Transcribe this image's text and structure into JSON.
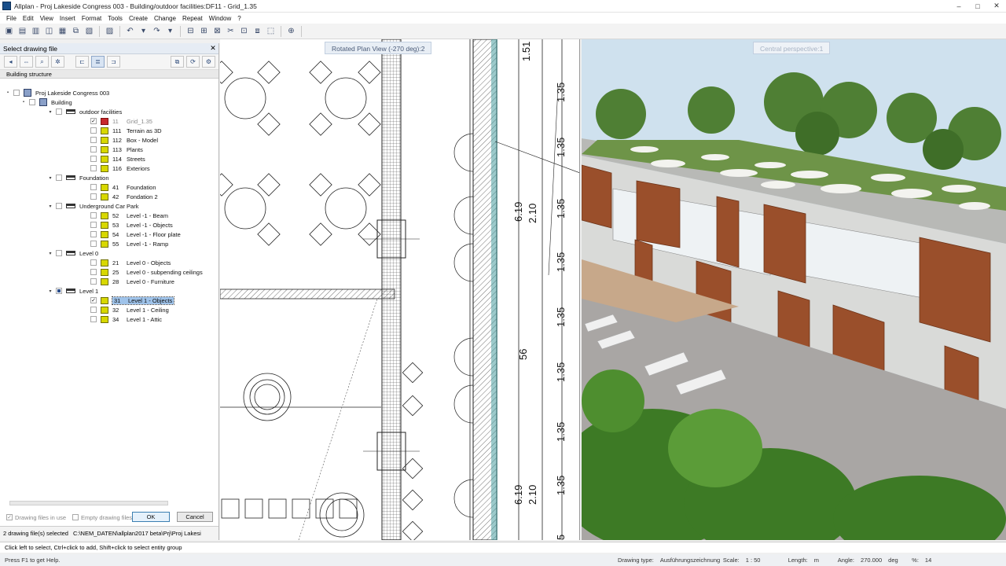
{
  "window": {
    "title": "Allplan - Proj Lakeside Congress 003 - Building/outdoor facilities:DF11 - Grid_1.35",
    "minimize": "–",
    "maximize": "□",
    "close": "✕"
  },
  "menu": [
    "File",
    "Edit",
    "View",
    "Insert",
    "Format",
    "Tools",
    "Create",
    "Change",
    "Repeat",
    "Window",
    "?"
  ],
  "toolbar_icons": [
    "new-icon",
    "open-icon",
    "print-icon",
    "preview-icon",
    "save-icon",
    "copy-icon",
    "paste-icon",
    "undo-icon",
    "redo-icon",
    "snap-icon",
    "grid-icon",
    "move-icon",
    "cut-icon",
    "layer-icon",
    "zoom-icon",
    "help-icon"
  ],
  "panel": {
    "title": "Select drawing file",
    "close": "✕",
    "tab": "Building structure",
    "tree": [
      {
        "level": 0,
        "toggle": "▪",
        "check": "",
        "icon": "bld",
        "num": "",
        "label": "Proj Lakeside Congress 003"
      },
      {
        "level": 1,
        "toggle": "▪",
        "check": "",
        "icon": "bld",
        "num": "",
        "label": "Building"
      },
      {
        "level": 2,
        "toggle": "▾",
        "check": "",
        "icon": "floor",
        "num": "",
        "label": "outdoor facilities"
      },
      {
        "level": 3,
        "toggle": "",
        "check": "✓",
        "icon": "red",
        "num": "11",
        "label": "Grid_1.35",
        "grey": true
      },
      {
        "level": 3,
        "toggle": "",
        "check": "",
        "icon": "df",
        "num": "111",
        "label": "Terrain as 3D"
      },
      {
        "level": 3,
        "toggle": "",
        "check": "",
        "icon": "df",
        "num": "112",
        "label": "Box - Model"
      },
      {
        "level": 3,
        "toggle": "",
        "check": "",
        "icon": "df",
        "num": "113",
        "label": "Plants"
      },
      {
        "level": 3,
        "toggle": "",
        "check": "",
        "icon": "df",
        "num": "114",
        "label": "Streets"
      },
      {
        "level": 3,
        "toggle": "",
        "check": "",
        "icon": "df",
        "num": "116",
        "label": "Exteriors"
      },
      {
        "level": 2,
        "toggle": "▾",
        "check": "",
        "icon": "floor",
        "num": "",
        "label": "Foundation"
      },
      {
        "level": 3,
        "toggle": "",
        "check": "",
        "icon": "df",
        "num": "41",
        "label": "Foundation"
      },
      {
        "level": 3,
        "toggle": "",
        "check": "",
        "icon": "df",
        "num": "42",
        "label": "Fondation 2"
      },
      {
        "level": 2,
        "toggle": "▾",
        "check": "",
        "icon": "floor",
        "num": "",
        "label": "Underground Car Park"
      },
      {
        "level": 3,
        "toggle": "",
        "check": "",
        "icon": "df",
        "num": "52",
        "label": "Level -1 - Beam"
      },
      {
        "level": 3,
        "toggle": "",
        "check": "",
        "icon": "df",
        "num": "53",
        "label": "Level -1 - Objects"
      },
      {
        "level": 3,
        "toggle": "",
        "check": "",
        "icon": "df",
        "num": "54",
        "label": "Level -1 - Floor plate"
      },
      {
        "level": 3,
        "toggle": "",
        "check": "",
        "icon": "df",
        "num": "55",
        "label": "Level -1 - Ramp"
      },
      {
        "level": 2,
        "toggle": "▾",
        "check": "",
        "icon": "floor",
        "num": "",
        "label": "Level 0"
      },
      {
        "level": 3,
        "toggle": "",
        "check": "",
        "icon": "df",
        "num": "21",
        "label": "Level 0 - Objects"
      },
      {
        "level": 3,
        "toggle": "",
        "check": "",
        "icon": "df",
        "num": "25",
        "label": "Level 0 - subpending ceilings"
      },
      {
        "level": 3,
        "toggle": "",
        "check": "",
        "icon": "df",
        "num": "28",
        "label": "Level 0 - Furniture"
      },
      {
        "level": 2,
        "toggle": "▾",
        "check": "half",
        "icon": "floor",
        "num": "",
        "label": "Level 1"
      },
      {
        "level": 3,
        "toggle": "",
        "check": "✓",
        "icon": "df",
        "num": "31",
        "label": "Level 1 - Objects",
        "selected": true
      },
      {
        "level": 3,
        "toggle": "",
        "check": "",
        "icon": "df",
        "num": "32",
        "label": "Level 1 - Ceiling"
      },
      {
        "level": 3,
        "toggle": "",
        "check": "",
        "icon": "df",
        "num": "34",
        "label": "Level 1 - Attic"
      }
    ],
    "foot_in_use": "Drawing files in use",
    "foot_empty": "Empty drawing files",
    "ok": "OK",
    "cancel": "Cancel",
    "status_left": "2 drawing file(s) selected",
    "status_path": "C:\\NEM_DATEN\\allplan2017 beta\\Prj\\Proj Lakesi"
  },
  "viewA": {
    "label": "Rotated Plan View (-270 deg):2",
    "dims": [
      "1.51",
      "1.35",
      "1.35",
      "1.35",
      "6.19",
      "2.10",
      "1.35",
      "1.35",
      "56",
      "1.35",
      "1.35",
      "1.35",
      "6.19",
      "2.10",
      "5"
    ]
  },
  "viewB": {
    "label": "Central perspective:1"
  },
  "hint": "Click left to select, Ctrl+click to add, Shift+click to select entity group",
  "status": {
    "help": "Press F1 to get Help.",
    "drawing_type_label": "Drawing type:",
    "drawing_type": "Ausführungszeichnung",
    "scale_label": "Scale:",
    "scale": "1 : 50",
    "length_label": "Length:",
    "length": "m",
    "angle_label": "Angle:",
    "angle": "270.000",
    "angle_unit": "deg",
    "pct_label": "%:",
    "pct": "14"
  }
}
